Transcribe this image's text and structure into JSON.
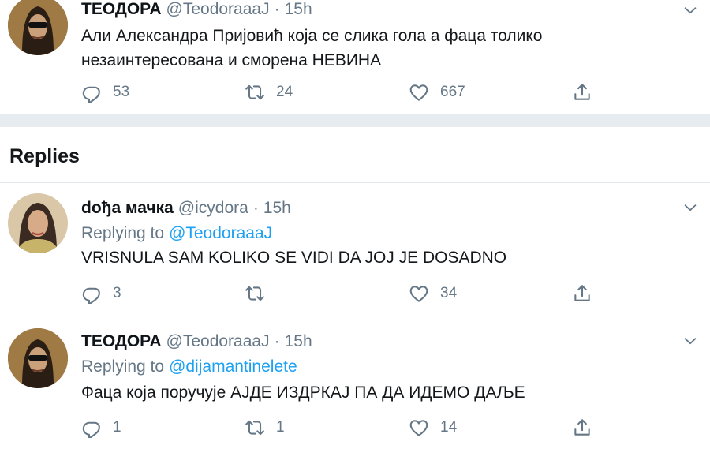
{
  "main_tweet": {
    "name": "ТЕОДОРА",
    "handle": "@TeodoraaaJ",
    "separator": "·",
    "time": "15h",
    "text_line1": "Али Александра Пријовић која се слика гола а фаца толико",
    "text_line2": "незаинтересована и сморена  НЕВИНА",
    "replies": "53",
    "retweets": "24",
    "likes": "667"
  },
  "replies_heading": "Replies",
  "reply1": {
    "name": "dођа мачка",
    "handle": "@icydora",
    "separator": "·",
    "time": "15h",
    "replying_label": "Replying to",
    "replying_to": "@TeodoraaaJ",
    "text": "VRISNULA SAM KOLIKO SE VIDI DA JOJ JE DOSADNO",
    "replies": "3",
    "retweets": "",
    "likes": "34"
  },
  "reply2": {
    "name": "ТЕОДОРА",
    "handle": "@TeodoraaaJ",
    "separator": "·",
    "time": "15h",
    "replying_label": "Replying to",
    "replying_to": "@dijamantinelete",
    "text": "Фаца која поручује АЈДЕ ИЗДРКАЈ ПА ДА ИДЕМО ДАЉЕ",
    "replies": "1",
    "retweets": "1",
    "likes": "14"
  },
  "icons": {
    "reply": "speech-bubble-icon",
    "retweet": "retweet-icon",
    "like": "heart-icon",
    "share": "share-icon",
    "menu": "chevron-down-icon"
  },
  "colors": {
    "link": "#1da1f2",
    "secondary": "#657786",
    "separator": "#e6ecf0"
  }
}
